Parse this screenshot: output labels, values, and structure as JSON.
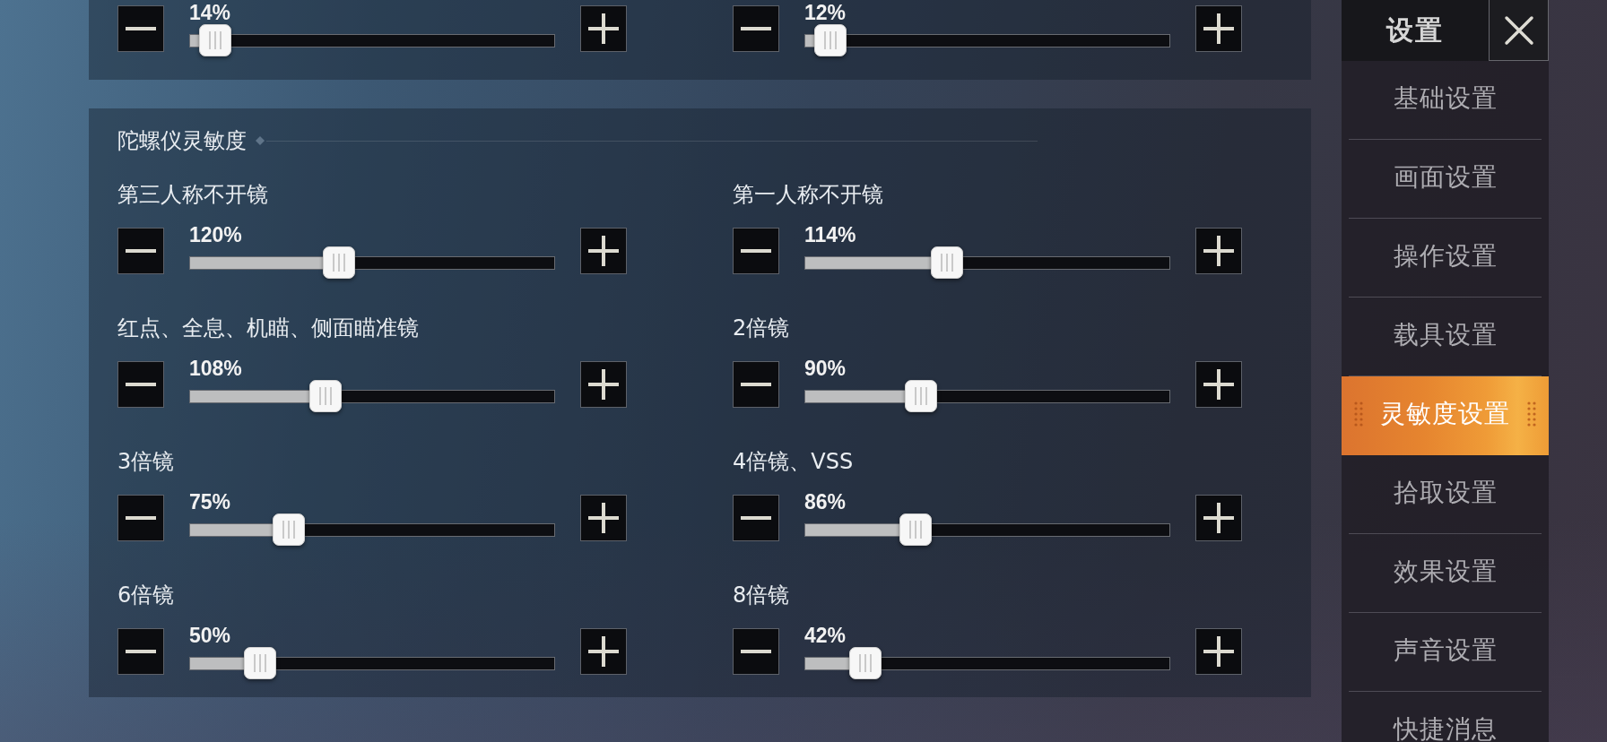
{
  "top_panel": {
    "sliders": [
      {
        "reading": "14%",
        "level": 0.03
      },
      {
        "reading": "12%",
        "level": 0.03
      }
    ]
  },
  "gyro_panel": {
    "title": "陀螺仪灵敏度",
    "sliders": [
      {
        "label": "第三人称不开镜",
        "reading": "120%",
        "level": 0.4
      },
      {
        "label": "第一人称不开镜",
        "reading": "114%",
        "level": 0.38
      },
      {
        "label": "红点、全息、机瞄、侧面瞄准镜",
        "reading": "108%",
        "level": 0.36
      },
      {
        "label": "2倍镜",
        "reading": "90%",
        "level": 0.3
      },
      {
        "label": "3倍镜",
        "reading": "75%",
        "level": 0.25
      },
      {
        "label": "4倍镜、VSS",
        "reading": "86%",
        "level": 0.285
      },
      {
        "label": "6倍镜",
        "reading": "50%",
        "level": 0.165
      },
      {
        "label": "8倍镜",
        "reading": "42%",
        "level": 0.134
      }
    ]
  },
  "sidebar": {
    "title": "设置",
    "items": [
      {
        "label": "基础设置",
        "selected": false
      },
      {
        "label": "画面设置",
        "selected": false
      },
      {
        "label": "操作设置",
        "selected": false
      },
      {
        "label": "载具设置",
        "selected": false
      },
      {
        "label": "灵敏度设置",
        "selected": true
      },
      {
        "label": "拾取设置",
        "selected": false
      },
      {
        "label": "效果设置",
        "selected": false
      },
      {
        "label": "声音设置",
        "selected": false
      },
      {
        "label": "快捷消息",
        "selected": false
      }
    ]
  }
}
